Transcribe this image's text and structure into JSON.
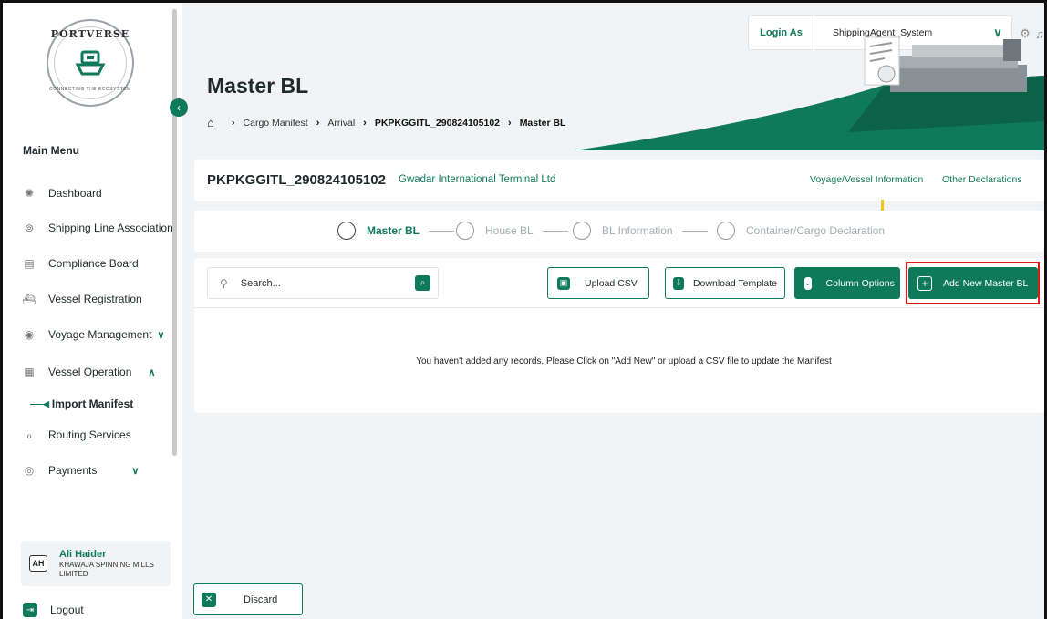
{
  "brand": {
    "name": "PORTVERSE",
    "tagline": "CONNECTING THE ECOSYSTEM"
  },
  "sidebar": {
    "menu_title": "Main Menu",
    "items": [
      {
        "label": "Dashboard",
        "icon": "dashboard-icon"
      },
      {
        "label": "Shipping Line Association",
        "icon": "anchor-icon"
      },
      {
        "label": "Compliance Board",
        "icon": "document-icon"
      },
      {
        "label": "Vessel Registration",
        "icon": "ship-icon"
      },
      {
        "label": "Voyage Management",
        "icon": "compass-icon",
        "expand": "∨"
      },
      {
        "label": "Vessel Operation",
        "icon": "container-icon",
        "expand": "∧"
      },
      {
        "label": "Routing Services",
        "icon": "route-icon"
      },
      {
        "label": "Payments",
        "icon": "coin-icon",
        "expand": "∨"
      }
    ],
    "sub_item": "Import Manifest"
  },
  "user": {
    "initials": "AH",
    "name": "Ali Haider",
    "org": "KHAWAJA SPINNING MILLS LIMITED"
  },
  "logout_label": "Logout",
  "topbar": {
    "login_as_label": "Login As",
    "role": "ShippingAgent_System"
  },
  "page": {
    "title": "Master BL",
    "breadcrumb": [
      "Cargo Manifest",
      "Arrival",
      "PKPKGGITL_290824105102",
      "Master BL"
    ]
  },
  "info": {
    "bl_number": "PKPKGGITL_290824105102",
    "terminal": "Gwadar International Terminal Ltd",
    "links": [
      "Voyage/Vessel Information",
      "Other Declarations"
    ]
  },
  "steps": [
    {
      "label": "Master BL",
      "state": "active"
    },
    {
      "label": "House BL",
      "state": "inactive"
    },
    {
      "label": "BL Information",
      "state": "inactive"
    },
    {
      "label": "Container/Cargo Declaration",
      "state": "inactive"
    }
  ],
  "toolbar": {
    "search_placeholder": "Search...",
    "upload_csv": "Upload CSV",
    "download_template": "Download Template",
    "column_options": "Column Options",
    "add_new": "Add New Master BL"
  },
  "empty_message": "You haven't added any records. Please Click on \"Add New\" or upload a CSV file to update the Manifest",
  "discard_label": "Discard",
  "colors": {
    "primary": "#0f7a5a",
    "background": "#f1f3f4",
    "highlight": "#e0191c"
  }
}
